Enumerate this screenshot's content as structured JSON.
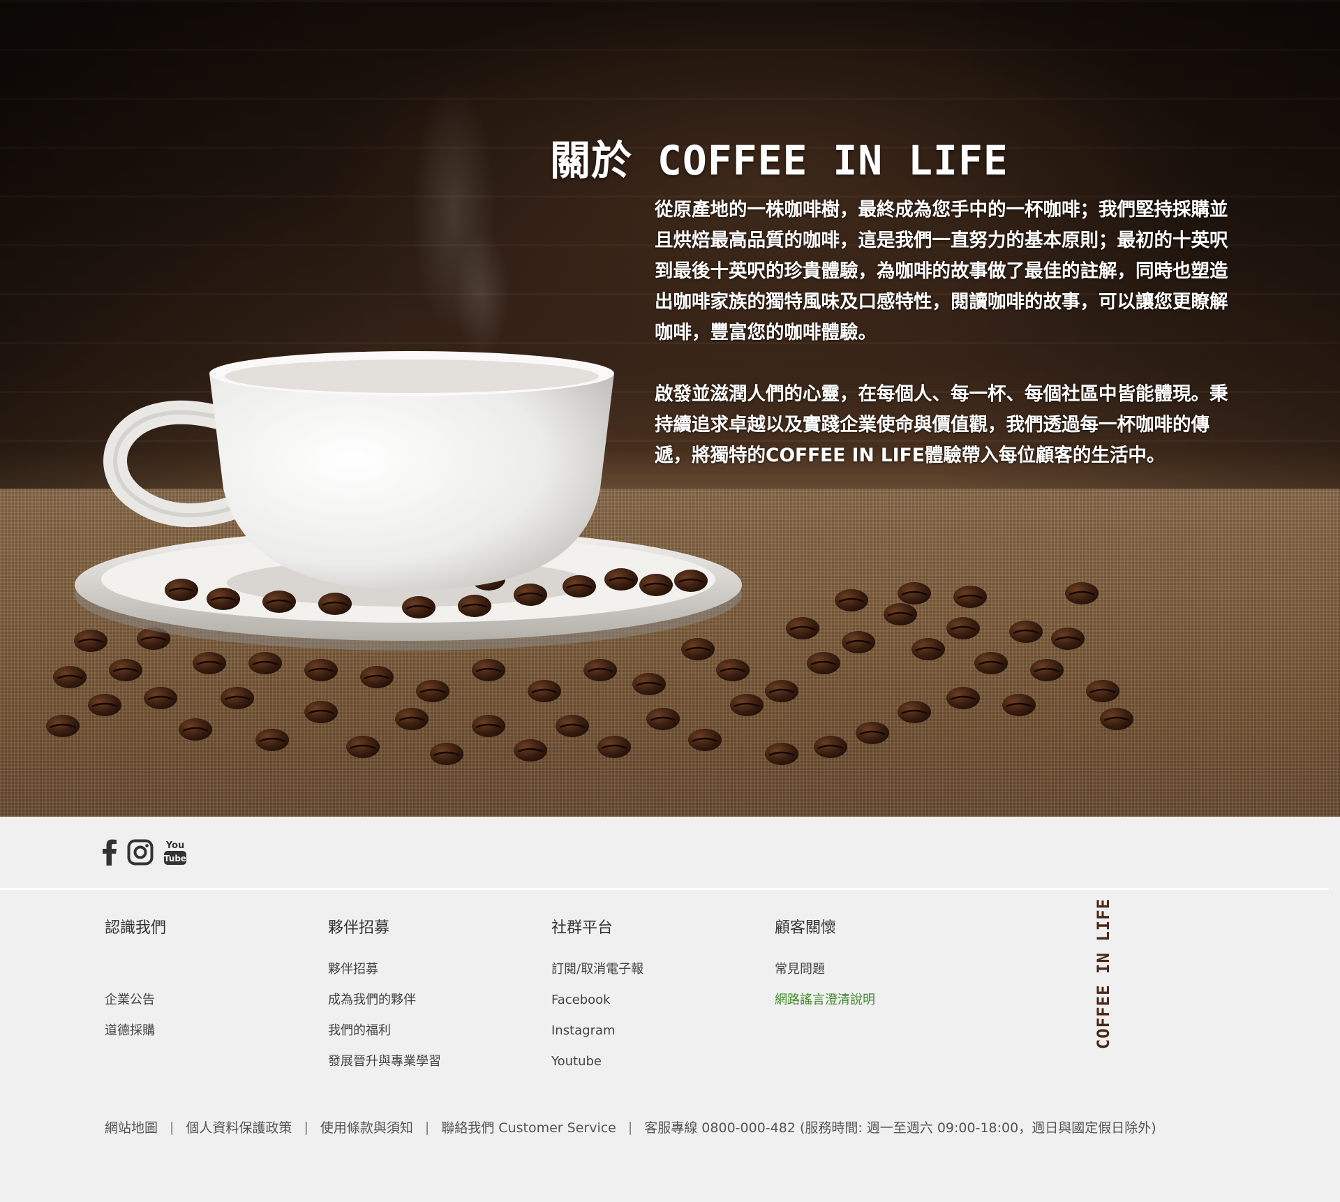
{
  "hero": {
    "title": "關於 COFFEE IN LIFE",
    "paragraph1": "從原產地的一株咖啡樹，最終成為您手中的一杯咖啡；我們堅持採購並且烘焙最高品質的咖啡，這是我們一直努力的基本原則；最初的十英呎到最後十英呎的珍貴體驗，為咖啡的故事做了最佳的註解，同時也塑造出咖啡家族的獨特風味及口感特性，閱讀咖啡的故事，可以讓您更瞭解咖啡，豐富您的咖啡體驗。",
    "paragraph2": "啟發並滋潤人們的心靈，在每個人、每一杯、每個社區中皆能體現。秉持續追求卓越以及實踐企業使命與價值觀，我們透過每一杯咖啡的傳遞，將獨特的COFFEE IN LIFE體驗帶入每位顧客的生活中。"
  },
  "social": {
    "facebook_icon": "facebook-icon",
    "instagram_icon": "instagram-icon",
    "youtube_icon": "youtube-icon",
    "youtube_text_top": "You",
    "youtube_text_bottom": "Tube"
  },
  "footer": {
    "columns": [
      {
        "title": "認識我們",
        "links": [
          "",
          "企業公告",
          "道德採購"
        ]
      },
      {
        "title": "夥伴招募",
        "links": [
          "夥伴招募",
          "成為我們的夥伴",
          "我們的福利",
          "發展晉升與專業學習"
        ]
      },
      {
        "title": "社群平台",
        "links": [
          "訂閱/取消電子報",
          "Facebook",
          "Instagram",
          "Youtube"
        ]
      },
      {
        "title": "顧客關懷",
        "links": [
          "常見問題",
          "網路謠言澄清說明"
        ]
      }
    ],
    "brand": "COFFEE IN LIFE",
    "bottom_links": [
      "網站地圖",
      "個人資料保護政策",
      "使用條款與須知",
      "聯絡我們 Customer Service",
      "客服專線 0800-000-482 (服務時間: 週一至週六 09:00-18:00，週日與國定假日除外)"
    ],
    "separator": "|",
    "link_green": "#3e8a2a",
    "brand_color": "#4a2817"
  }
}
